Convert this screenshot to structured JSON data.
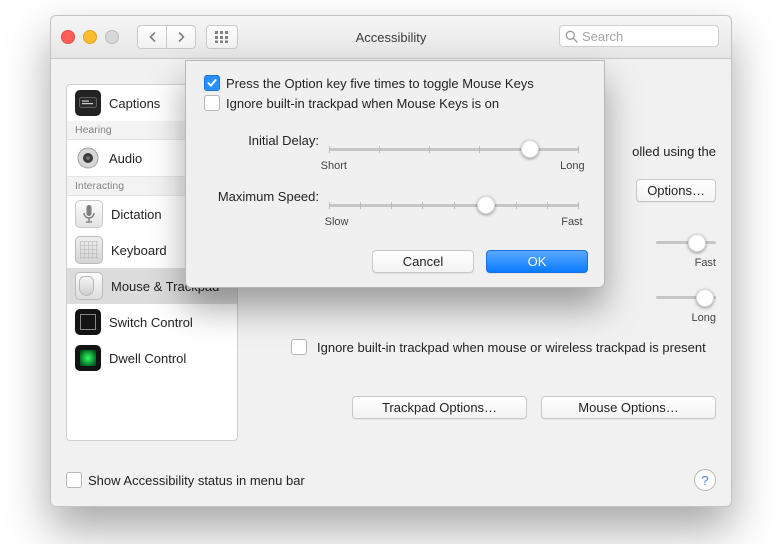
{
  "window": {
    "title": "Accessibility",
    "search_placeholder": "Search"
  },
  "sidebar": {
    "cat_hearing": "Hearing",
    "cat_interacting": "Interacting",
    "items": {
      "captions": "Captions",
      "audio": "Audio",
      "dictation": "Dictation",
      "keyboard": "Keyboard",
      "mouse_trackpad": "Mouse & Trackpad",
      "switch_control": "Switch Control",
      "dwell_control": "Dwell Control"
    }
  },
  "main": {
    "partial_text_right": "olled using the",
    "options_btn": "Options…",
    "fast_label": "Fast",
    "long_label": "Long",
    "ignore_trackpad_label": "Ignore built-in trackpad when mouse or wireless trackpad is present",
    "trackpad_options_btn": "Trackpad Options…",
    "mouse_options_btn": "Mouse Options…"
  },
  "footer": {
    "show_status_label": "Show Accessibility status in menu bar"
  },
  "sheet": {
    "check_toggle_label": "Press the Option key five times to toggle Mouse Keys",
    "check_ignore_label": "Ignore built-in trackpad when Mouse Keys is on",
    "initial_delay_label": "Initial Delay:",
    "short": "Short",
    "long": "Long",
    "max_speed_label": "Maximum Speed:",
    "slow": "Slow",
    "fast": "Fast",
    "cancel": "Cancel",
    "ok": "OK"
  }
}
